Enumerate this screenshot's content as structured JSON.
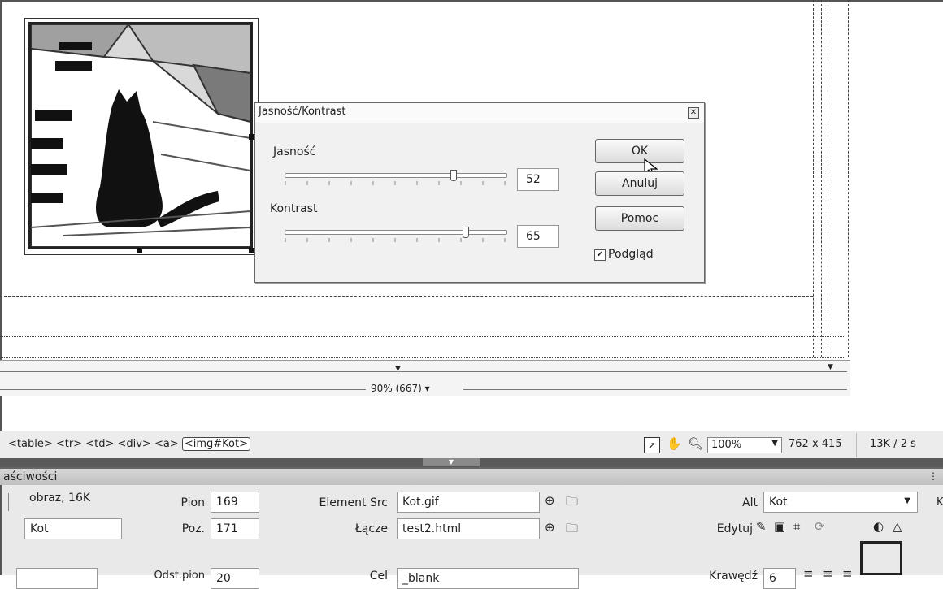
{
  "dialog": {
    "title": "Jasność/Kontrast",
    "brightness_label": "Jasność",
    "brightness_value": "52",
    "contrast_label": "Kontrast",
    "contrast_value": "65",
    "ok_label": "OK",
    "cancel_label": "Anuluj",
    "help_label": "Pomoc",
    "preview_label": "Podgląd",
    "preview_checked": true
  },
  "ruler": {
    "width_label": "90% (667)"
  },
  "tagbar": {
    "tags_plain": "<table> <tr> <td> <div> <a>",
    "selected_tag": "<img#Kot>",
    "zoom": "100%",
    "dimensions": "762 x 415",
    "size": "13K / 2 s"
  },
  "properties": {
    "panel_title": "aściwości",
    "type_label": "obraz, 16K",
    "id_value": "Kot",
    "pion_label": "Pion",
    "pion_value": "169",
    "poz_label": "Poz.",
    "poz_value": "171",
    "src_label": "Element Src",
    "src_value": "Kot.gif",
    "link_label": "Łącze",
    "link_value": "test2.html",
    "alt_label": "Alt",
    "alt_value": "Kot",
    "edit_label": "Edytuj",
    "partial_row": {
      "odst_label": "Odst.pion",
      "odst_value": "20",
      "cel_label": "Cel",
      "cel_value": "_blank",
      "border_label": "Krawędź",
      "border_value": "6"
    },
    "cut_label_right": "K"
  }
}
